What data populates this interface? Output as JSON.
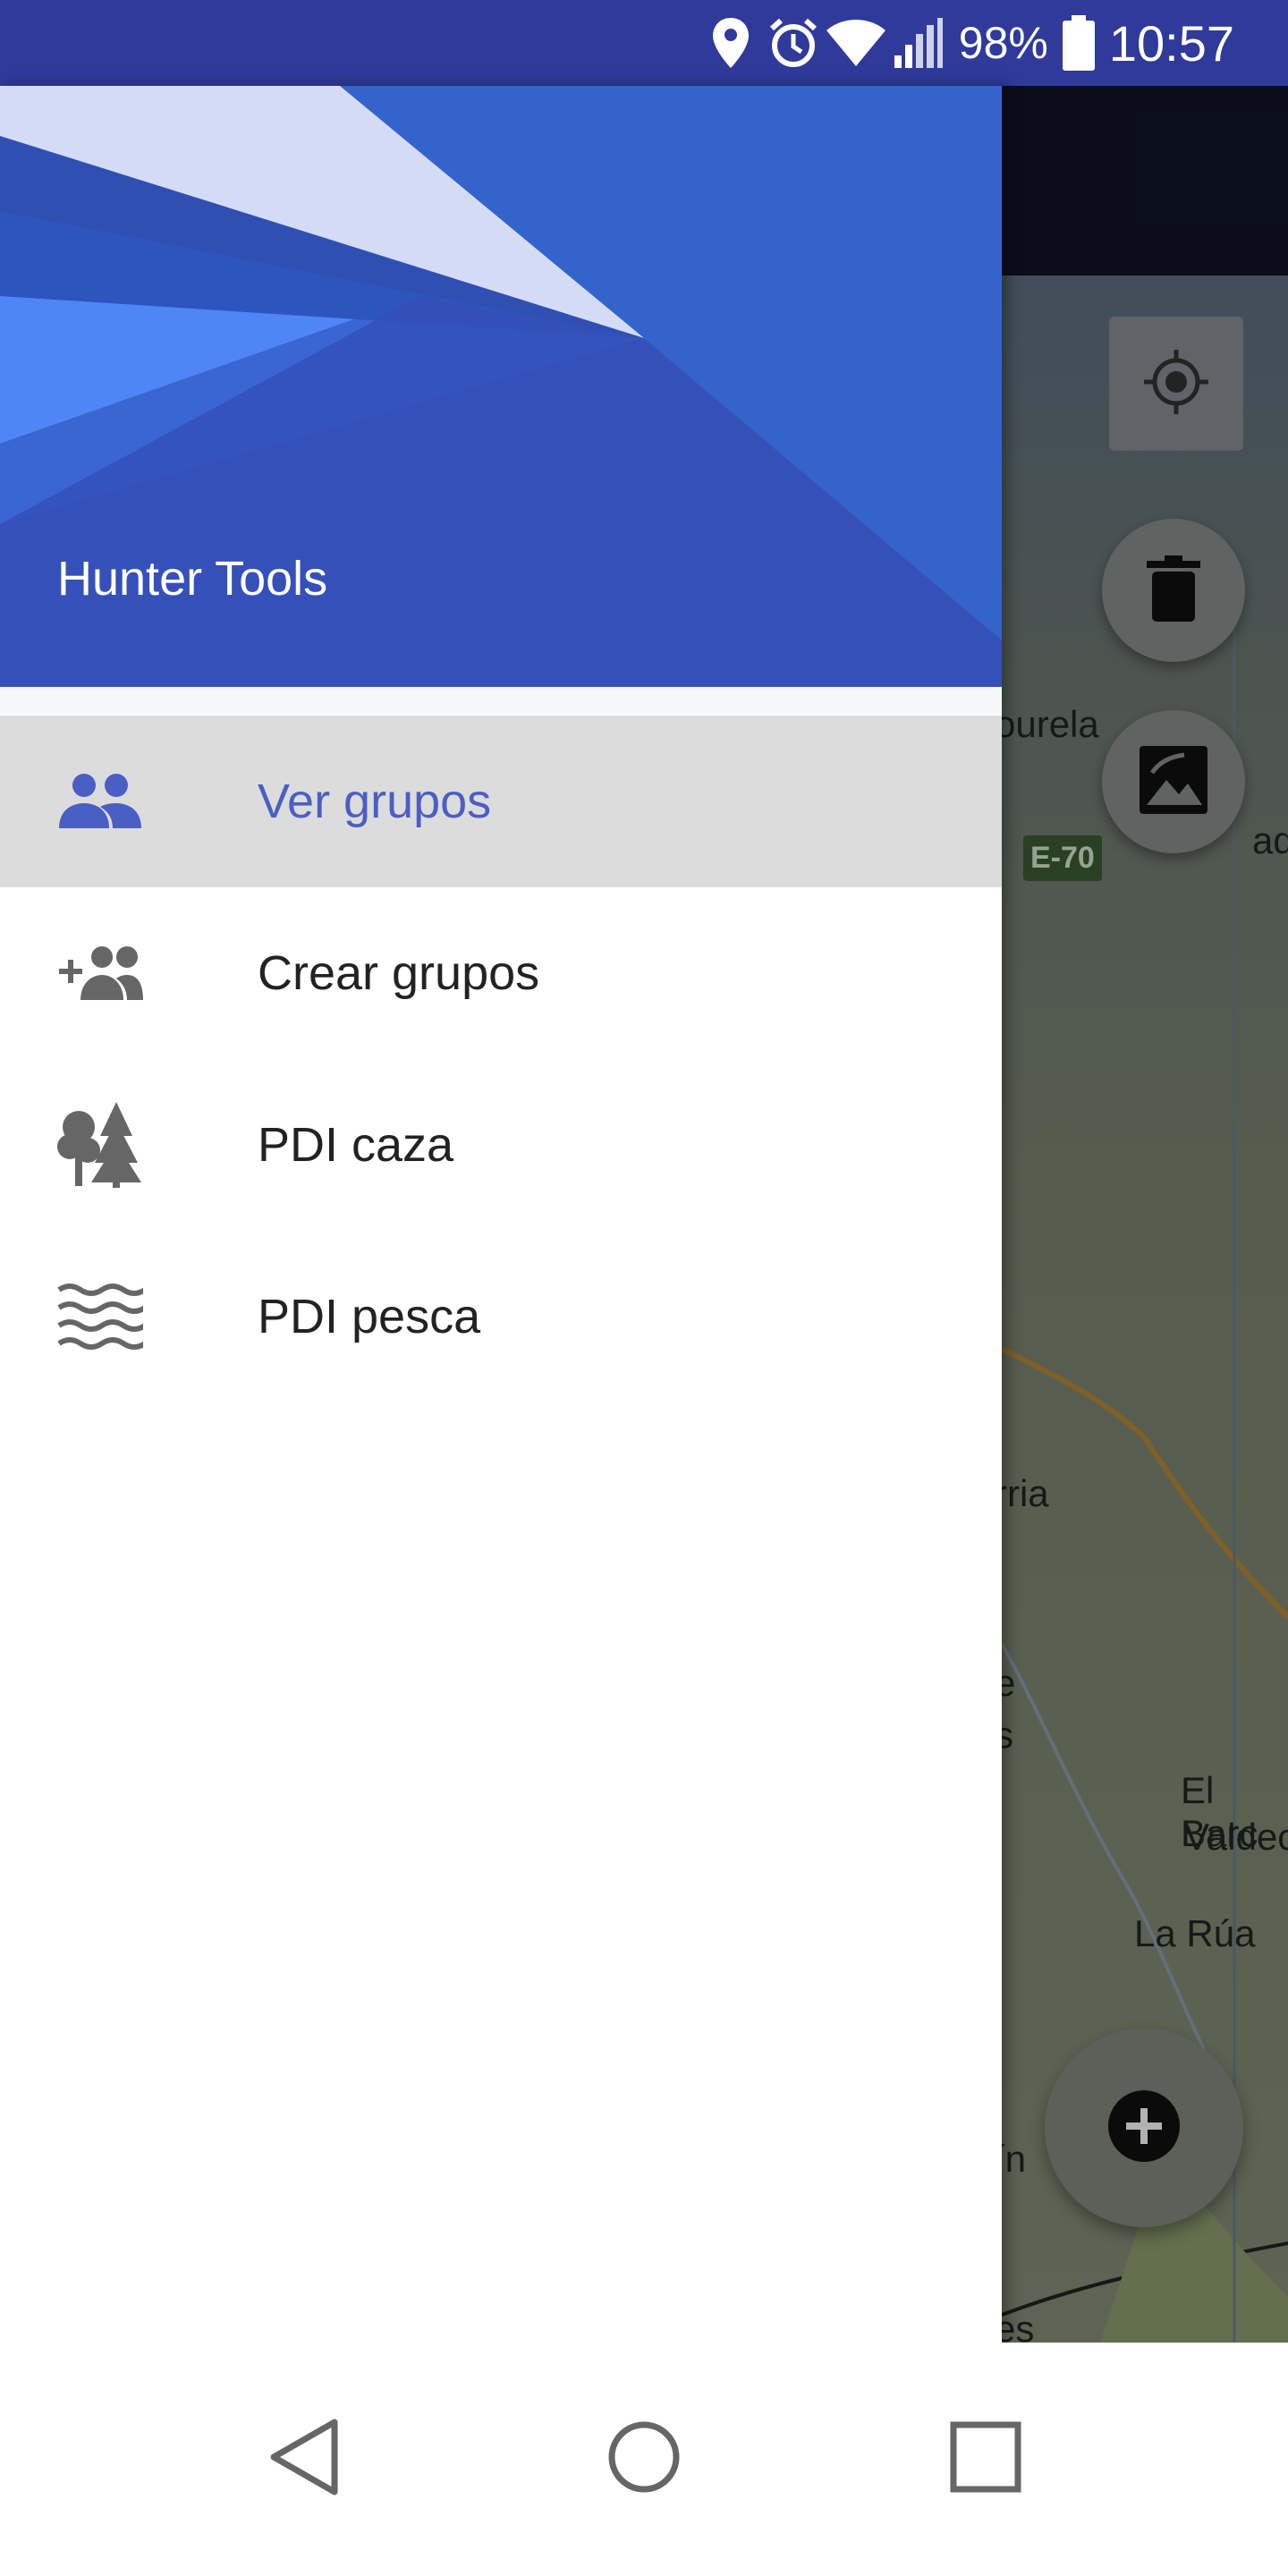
{
  "status_bar": {
    "battery_percent": "98%",
    "time": "10:57",
    "icons": [
      "location-icon",
      "alarm-icon",
      "wifi-icon",
      "signal-icon",
      "battery-icon"
    ],
    "background_color": "#2f3a9b"
  },
  "drawer": {
    "title": "Hunter Tools",
    "header_color": "#3550b8",
    "items": [
      {
        "label": "Ver grupos",
        "icon": "group-icon",
        "active": true
      },
      {
        "label": "Crear grupos",
        "icon": "group-add-icon",
        "active": false
      },
      {
        "label": "PDI caza",
        "icon": "forest-icon",
        "active": false
      },
      {
        "label": "PDI pesca",
        "icon": "waves-icon",
        "active": false
      }
    ],
    "active_color": "#4a5fc4"
  },
  "map": {
    "labels": [
      "ourela",
      "ade",
      "rria",
      "e",
      "s",
      "El Barc",
      "Valdec",
      "La Rúa",
      "ín",
      "es"
    ],
    "road_badge": "E-70",
    "buttons": [
      "my-location-icon",
      "delete-icon",
      "image-icon",
      "add-icon"
    ]
  },
  "nav_bar": {
    "buttons": [
      "back-icon",
      "home-icon",
      "recents-icon"
    ]
  }
}
